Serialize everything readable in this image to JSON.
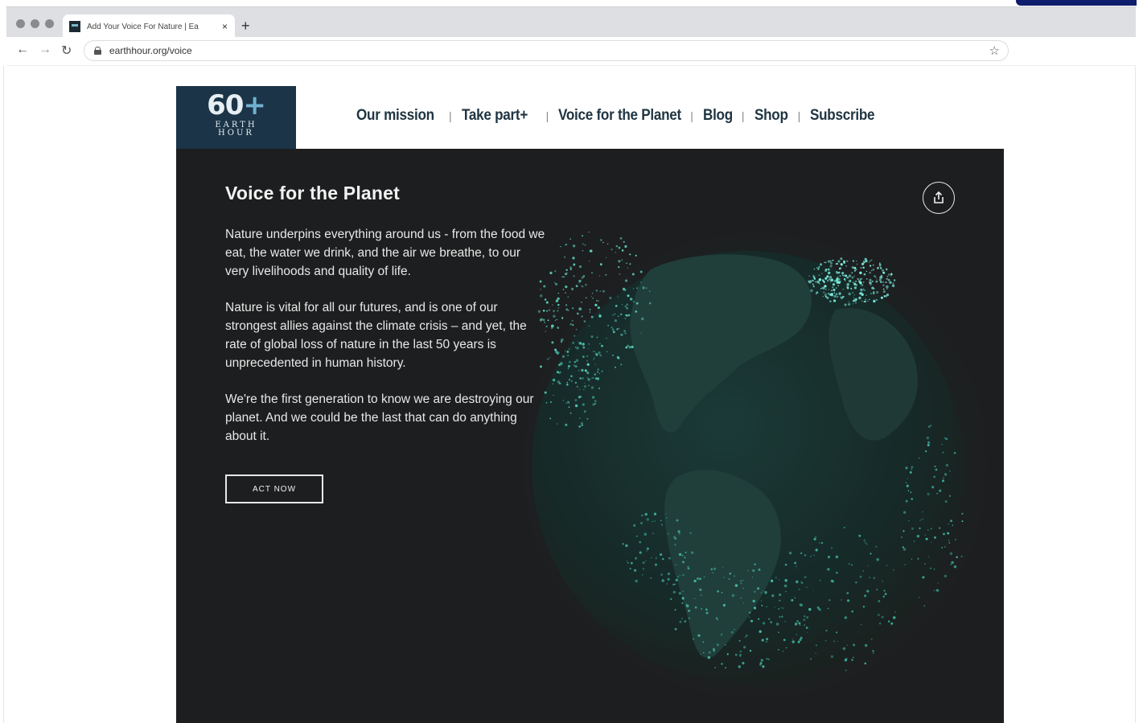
{
  "browser": {
    "tab_title": "Add Your Voice For Nature | Ea",
    "tab_close": "×",
    "new_tab": "+",
    "url": "earthhour.org/voice",
    "back": "←",
    "forward": "→",
    "reload": "↻",
    "bookmark": "☆"
  },
  "logo": {
    "number": "60",
    "plus": "+",
    "line1": "EARTH",
    "line2": "HOUR"
  },
  "nav": {
    "items": [
      "Our mission",
      "Take part+",
      "Voice for the Planet",
      "Blog",
      "Shop",
      "Subscribe"
    ],
    "separator": "|"
  },
  "hero": {
    "title": "Voice for the Planet",
    "paragraphs": [
      "Nature underpins everything around us - from the food we eat, the water we drink, and the air we breathe, to our very livelihoods and quality of life.",
      "Nature is vital for all our futures, and is one of our strongest allies against the climate crisis – and yet, the rate of global loss of nature in the last 50 years is unprecedented in human history.",
      "We're the first generation to know we are destroying our planet. And we could be the last that can do anything about it."
    ],
    "cta": "ACT NOW"
  },
  "colors": {
    "hero_bg": "#1d1e1f",
    "logo_bg": "#1b3447",
    "nav_text": "#1f3441",
    "accent_glow": "#3fe0d0"
  },
  "icons": [
    "lock-icon",
    "bookmark-star-icon",
    "share-icon",
    "globe-visual"
  ]
}
